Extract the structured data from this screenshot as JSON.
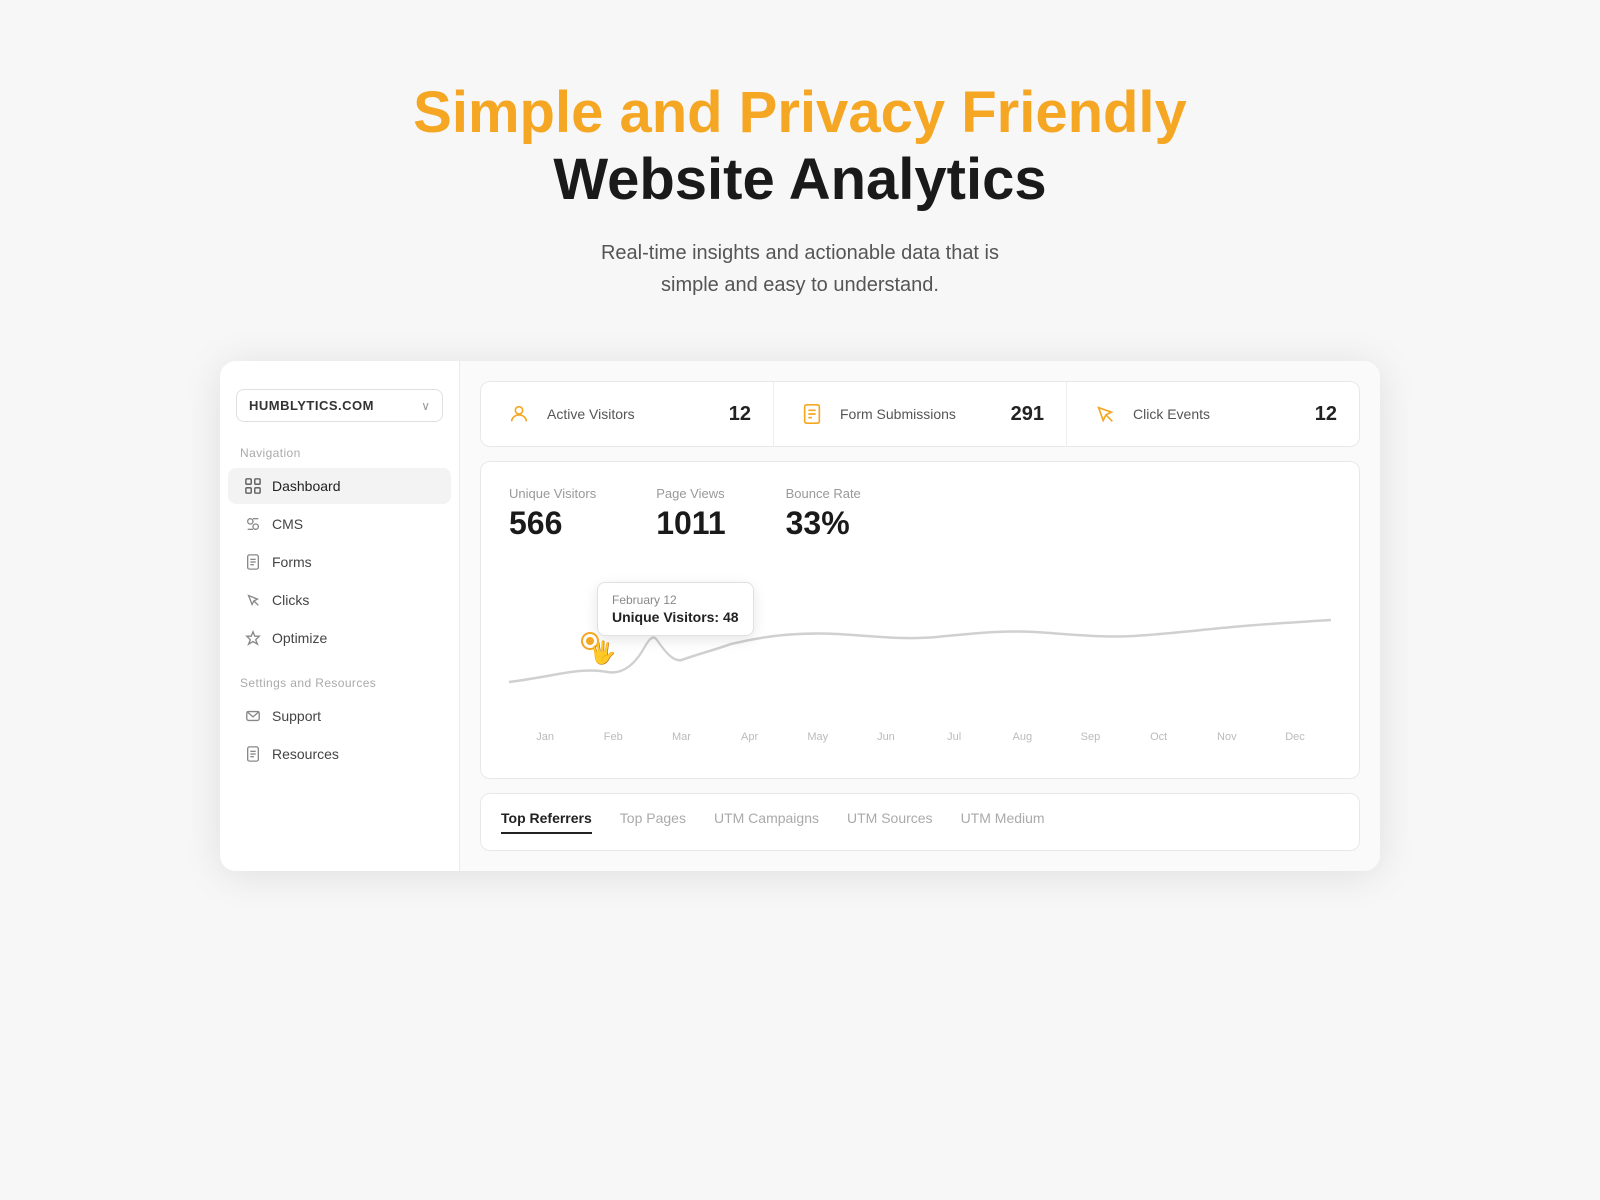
{
  "hero": {
    "title_orange": "Simple and Privacy Friendly",
    "title_dark": "Website Analytics",
    "subtitle_line1": "Real-time insights and actionable data that is",
    "subtitle_line2": "simple and easy to understand."
  },
  "sidebar": {
    "site_name": "HUMBLYTICS.COM",
    "chevron": "∨",
    "nav_section_label": "Navigation",
    "nav_items": [
      {
        "id": "dashboard",
        "label": "Dashboard",
        "active": true
      },
      {
        "id": "cms",
        "label": "CMS",
        "active": false
      },
      {
        "id": "forms",
        "label": "Forms",
        "active": false
      },
      {
        "id": "clicks",
        "label": "Clicks",
        "active": false
      },
      {
        "id": "optimize",
        "label": "Optimize",
        "active": false
      }
    ],
    "settings_section_label": "Settings and Resources",
    "settings_items": [
      {
        "id": "support",
        "label": "Support"
      },
      {
        "id": "resources",
        "label": "Resources"
      }
    ]
  },
  "stats": [
    {
      "id": "active-visitors",
      "label": "Active Visitors",
      "value": "12"
    },
    {
      "id": "form-submissions",
      "label": "Form Submissions",
      "value": "291"
    },
    {
      "id": "click-events",
      "label": "Click Events",
      "value": "12"
    }
  ],
  "analytics": {
    "metrics": [
      {
        "id": "unique-visitors",
        "label": "Unique Visitors",
        "value": "566"
      },
      {
        "id": "page-views",
        "label": "Page Views",
        "value": "1011"
      },
      {
        "id": "bounce-rate",
        "label": "Bounce Rate",
        "value": "33%"
      }
    ],
    "tooltip": {
      "date": "February 12",
      "value_label": "Unique Visitors: 48"
    },
    "x_labels": [
      "Jan",
      "Feb",
      "Mar",
      "Apr",
      "May",
      "Jun",
      "Jul",
      "Aug",
      "Sep",
      "Oct",
      "Nov",
      "Dec"
    ]
  },
  "bottom_tabs": [
    {
      "id": "top-referrers",
      "label": "Top Referrers",
      "active": true
    },
    {
      "id": "top-pages",
      "label": "Top Pages",
      "active": false
    },
    {
      "id": "utm-campaigns",
      "label": "UTM Campaigns",
      "active": false
    },
    {
      "id": "utm-sources",
      "label": "UTM Sources",
      "active": false
    },
    {
      "id": "utm-medium",
      "label": "UTM Medium",
      "active": false
    }
  ]
}
